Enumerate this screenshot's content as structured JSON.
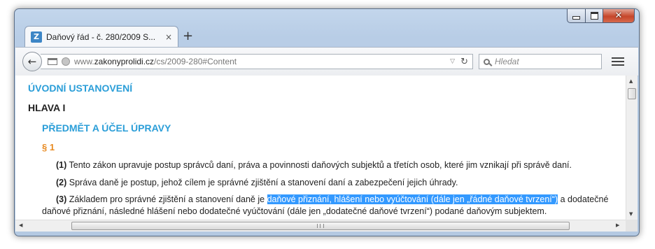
{
  "window": {
    "tab_title": "Daňový řád - č. 280/2009 S...",
    "tab_close": "×",
    "new_tab": "+",
    "favicon_letter": "Z"
  },
  "navbar": {
    "back_icon": "←",
    "url_prefix": "www.",
    "url_host": "zakonyprolidi.cz",
    "url_path": "/cs/2009-280#Content",
    "search_placeholder": "Hledat",
    "reload_icon": "↻",
    "dropdown_icon": "▽"
  },
  "content": {
    "section_title": "ÚVODNÍ USTANOVENÍ",
    "part_title": "HLAVA I",
    "subtitle": "PŘEDMĚT A ÚČEL ÚPRAVY",
    "paragraph_mark": "§ 1",
    "p1_num": "(1)",
    "p1_text": " Tento zákon upravuje postup správců daní, práva a povinnosti daňových subjektů a třetích osob, které jim vznikají při správě daní.",
    "p2_num": "(2)",
    "p2_text": " Správa daně je postup, jehož cílem je správné zjištění a stanovení daní a zabezpečení jejich úhrady.",
    "p3_num": "(3)",
    "p3_text_a": " Základem pro správné zjištění a stanovení daně je ",
    "p3_selected": "daňové přiznání, hlášení nebo vyúčtování (dále jen „řádné daňové tvrzení“)",
    "p3_text_b": " a dodatečné",
    "p3_line2": "daňové přiznání, následné hlášení nebo dodatečné vyúčtování (dále jen „dodatečné daňové tvrzení“) podané daňovým subjektem."
  },
  "colors": {
    "heading_blue": "#2b9ed8",
    "heading_orange": "#e8891f",
    "selection": "#3399ff"
  }
}
